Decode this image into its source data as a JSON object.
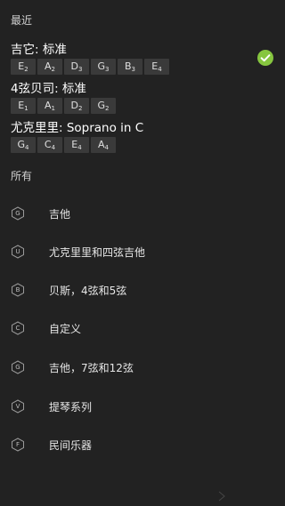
{
  "recent": {
    "header": "最近",
    "tunings": [
      {
        "title": "吉它: 标准",
        "notes": [
          {
            "letter": "E",
            "octave": "2"
          },
          {
            "letter": "A",
            "octave": "2"
          },
          {
            "letter": "D",
            "octave": "3"
          },
          {
            "letter": "G",
            "octave": "3"
          },
          {
            "letter": "B",
            "octave": "3"
          },
          {
            "letter": "E",
            "octave": "4"
          }
        ],
        "selected": true
      },
      {
        "title": "4弦贝司: 标准",
        "notes": [
          {
            "letter": "E",
            "octave": "1"
          },
          {
            "letter": "A",
            "octave": "1"
          },
          {
            "letter": "D",
            "octave": "2"
          },
          {
            "letter": "G",
            "octave": "2"
          }
        ],
        "selected": false
      },
      {
        "title": "尤克里里: Soprano in C",
        "notes": [
          {
            "letter": "G",
            "octave": "4"
          },
          {
            "letter": "C",
            "octave": "4"
          },
          {
            "letter": "E",
            "octave": "4"
          },
          {
            "letter": "A",
            "octave": "4"
          }
        ],
        "selected": false
      }
    ]
  },
  "all": {
    "header": "所有",
    "categories": [
      {
        "icon": "G",
        "label": "吉他"
      },
      {
        "icon": "U",
        "label": "尤克里里和四弦吉他"
      },
      {
        "icon": "B",
        "label": "贝斯，4弦和5弦"
      },
      {
        "icon": "C",
        "label": "自定义"
      },
      {
        "icon": "G",
        "label": "吉他，7弦和12弦"
      },
      {
        "icon": "V",
        "label": "提琴系列"
      },
      {
        "icon": "F",
        "label": "民间乐器"
      }
    ]
  },
  "colors": {
    "background": "#222222",
    "note_chip": "#3a3a3a",
    "accent_check": "#86c63f"
  }
}
